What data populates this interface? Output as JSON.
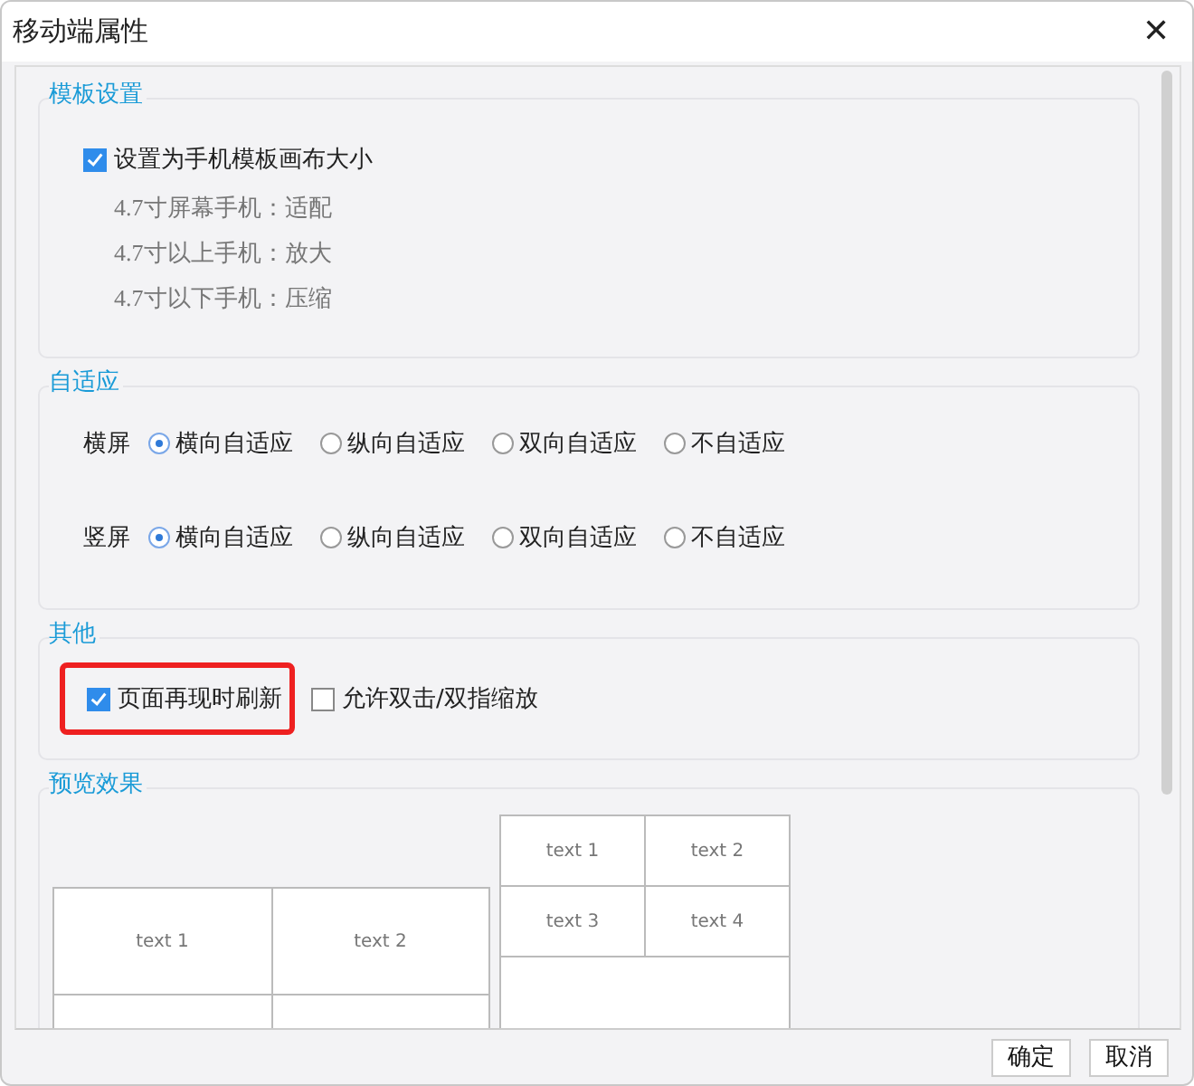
{
  "window": {
    "title": "移动端属性",
    "close": "✕"
  },
  "template_settings": {
    "legend": "模板设置",
    "option": {
      "label": "设置为手机模板画布大小",
      "checked": true
    },
    "notes": [
      "4.7寸屏幕手机：适配",
      "4.7寸以上手机：放大",
      "4.7寸以下手机：压缩"
    ]
  },
  "adaptive": {
    "legend": "自适应",
    "rows": [
      {
        "label": "横屏",
        "options": [
          {
            "label": "横向自适应",
            "selected": true
          },
          {
            "label": "纵向自适应",
            "selected": false
          },
          {
            "label": "双向自适应",
            "selected": false
          },
          {
            "label": "不自适应",
            "selected": false
          }
        ]
      },
      {
        "label": "竖屏",
        "options": [
          {
            "label": "横向自适应",
            "selected": true
          },
          {
            "label": "纵向自适应",
            "selected": false
          },
          {
            "label": "双向自适应",
            "selected": false
          },
          {
            "label": "不自适应",
            "selected": false
          }
        ]
      }
    ]
  },
  "other": {
    "legend": "其他",
    "options": [
      {
        "label": "页面再现时刷新",
        "checked": true,
        "highlighted": true
      },
      {
        "label": "允许双击/双指缩放",
        "checked": false,
        "highlighted": false
      }
    ]
  },
  "preview": {
    "legend": "预览效果",
    "landscape": {
      "rows": [
        [
          "text 1",
          "text 2"
        ]
      ]
    },
    "portrait": {
      "rows": [
        [
          "text 1",
          "text 2"
        ],
        [
          "text 3",
          "text 4"
        ]
      ]
    }
  },
  "buttons": [
    "确定",
    "取消"
  ]
}
